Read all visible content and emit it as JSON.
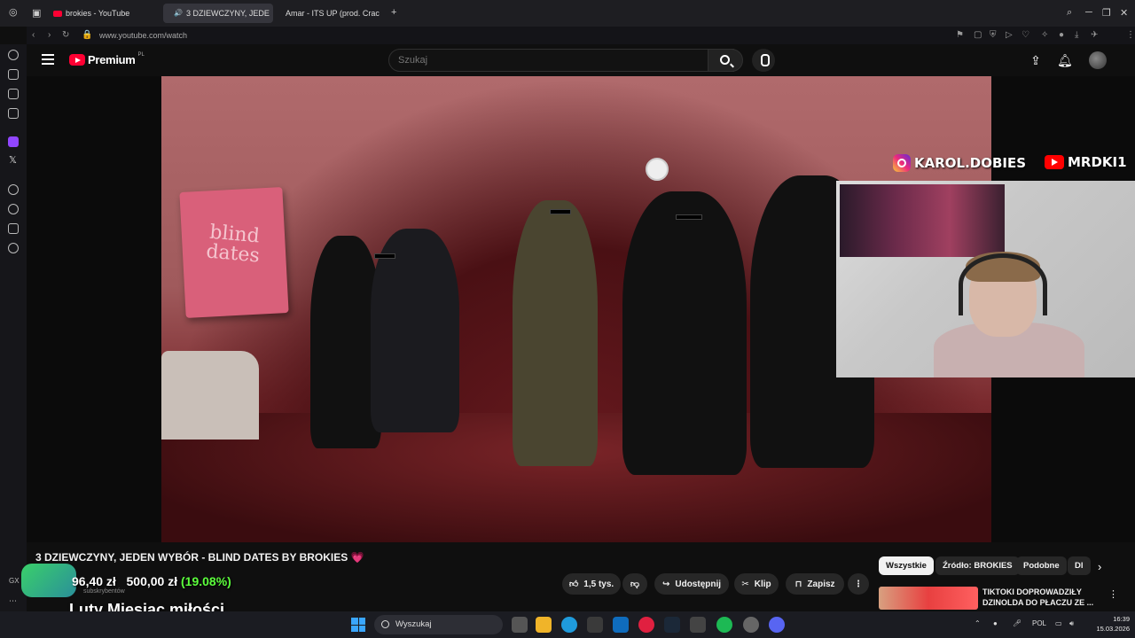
{
  "browser": {
    "tabs": [
      {
        "label": "brokies - YouTube"
      },
      {
        "label": "3 DZIEWCZYNY, JEDE"
      },
      {
        "label": "Amar - ITS UP (prod. Crac"
      }
    ],
    "url": "www.youtube.com/watch"
  },
  "youtube": {
    "logo_text": "Premium",
    "logo_region": "PL",
    "search_placeholder": "Szukaj"
  },
  "video": {
    "sign_text": "blind dates",
    "overlay_instagram": "KAROL.DOBIES",
    "overlay_youtube": "MRDKI1",
    "title": "3 DZIEWCZYNY, JEDEN WYBÓR - BLIND DATES BY BROKIES",
    "title_emoji": "💗"
  },
  "actions": {
    "like_count": "1,5 tys.",
    "share": "Udostępnij",
    "clip": "Klip",
    "save": "Zapisz",
    "more": "⋮"
  },
  "chips": [
    {
      "label": "Wszystkie",
      "active": true
    },
    {
      "label": "Źródło: BROKIES",
      "active": false
    },
    {
      "label": "Podobne",
      "active": false
    },
    {
      "label": "Dl",
      "active": false
    }
  ],
  "recommended": {
    "title": "TIKTOKI DOPROWADZIŁY DZINOLDA DO PŁACZU ZE ..."
  },
  "stream_overlay": {
    "donation_current": "96,40 zł",
    "donation_goal": "500,00 zł",
    "donation_percent": "(19.08%)",
    "donation_sub": "subskrybentów",
    "banner": "Luty Miesiąc miłości",
    "gx_label": "GX"
  },
  "taskbar": {
    "search": "Wyszukaj",
    "lang": "POL",
    "time": "16:39",
    "date": "15.03.2026"
  }
}
